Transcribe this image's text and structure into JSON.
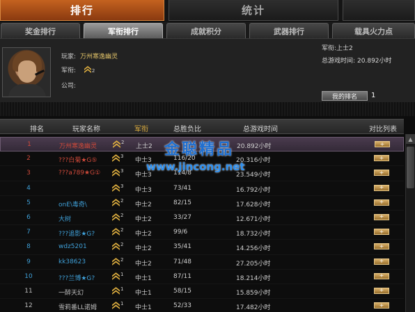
{
  "main_tabs": [
    {
      "label": "排行",
      "active": true
    },
    {
      "label": "统计",
      "active": false
    }
  ],
  "sub_tabs": [
    {
      "label": "奖金排行",
      "active": false
    },
    {
      "label": "军衔排行",
      "active": true
    },
    {
      "label": "成就积分",
      "active": false
    },
    {
      "label": "武器排行",
      "active": false
    },
    {
      "label": "载具火力点",
      "active": false
    }
  ],
  "player": {
    "name_label": "玩家:",
    "name": "万州寒逸幽灵",
    "rank_label": "军衔:",
    "rank_level": "2",
    "company_label": "公司:",
    "company": ""
  },
  "summary": {
    "rank_label": "军衔:",
    "rank_value": "上士2",
    "time_label": "总游戏时间:",
    "time_value": "20.892小时",
    "my_rank_button": "我的排名",
    "my_rank_value": "1"
  },
  "table": {
    "headers": [
      "排名",
      "玩家名称",
      "军衔",
      "总胜负比",
      "总游戏时间",
      "对比列表"
    ],
    "rows": [
      {
        "rank": "1",
        "name": "万州寒逸幽灵",
        "level": "2",
        "title": "上士2",
        "wl": "",
        "time": "20.892小时",
        "color": "red",
        "selected": true
      },
      {
        "rank": "2",
        "name": "???白菊★G⑤",
        "level": "3",
        "title": "中士3",
        "wl": "116/20",
        "time": "20.316小时",
        "color": "red",
        "selected": false
      },
      {
        "rank": "3",
        "name": "???a789★G①",
        "level": "3",
        "title": "中士3",
        "wl": "114/8",
        "time": "23.549小时",
        "color": "red",
        "selected": false
      },
      {
        "rank": "4",
        "name": "",
        "level": "3",
        "title": "中士3",
        "wl": "73/41",
        "time": "16.792小时",
        "color": "blue",
        "selected": false
      },
      {
        "rank": "5",
        "name": "onE\\毒奇\\",
        "level": "2",
        "title": "中士2",
        "wl": "82/15",
        "time": "17.628小时",
        "color": "blue",
        "selected": false
      },
      {
        "rank": "6",
        "name": "大树",
        "level": "2",
        "title": "中士2",
        "wl": "33/27",
        "time": "12.671小时",
        "color": "blue",
        "selected": false
      },
      {
        "rank": "7",
        "name": "???追影★G?",
        "level": "2",
        "title": "中士2",
        "wl": "99/6",
        "time": "18.732小时",
        "color": "blue",
        "selected": false
      },
      {
        "rank": "8",
        "name": "wdz5201",
        "level": "2",
        "title": "中士2",
        "wl": "35/41",
        "time": "14.256小时",
        "color": "blue",
        "selected": false
      },
      {
        "rank": "9",
        "name": "kk38623",
        "level": "2",
        "title": "中士2",
        "wl": "71/48",
        "time": "27.205小时",
        "color": "blue",
        "selected": false
      },
      {
        "rank": "10",
        "name": "???兰博★G?",
        "level": "1",
        "title": "中士1",
        "wl": "87/11",
        "time": "18.214小时",
        "color": "blue",
        "selected": false
      },
      {
        "rank": "11",
        "name": "一醉天幻",
        "level": "1",
        "title": "中士1",
        "wl": "58/15",
        "time": "15.859小时",
        "color": "gray",
        "selected": false
      },
      {
        "rank": "12",
        "name": "雪莉番LL诺姆",
        "level": "1",
        "title": "中士1",
        "wl": "52/33",
        "time": "17.482小时",
        "color": "gray",
        "selected": false
      }
    ],
    "compare_button": "+"
  },
  "watermark": {
    "line1": "金聪精品",
    "line2": "www.jincong.net"
  }
}
